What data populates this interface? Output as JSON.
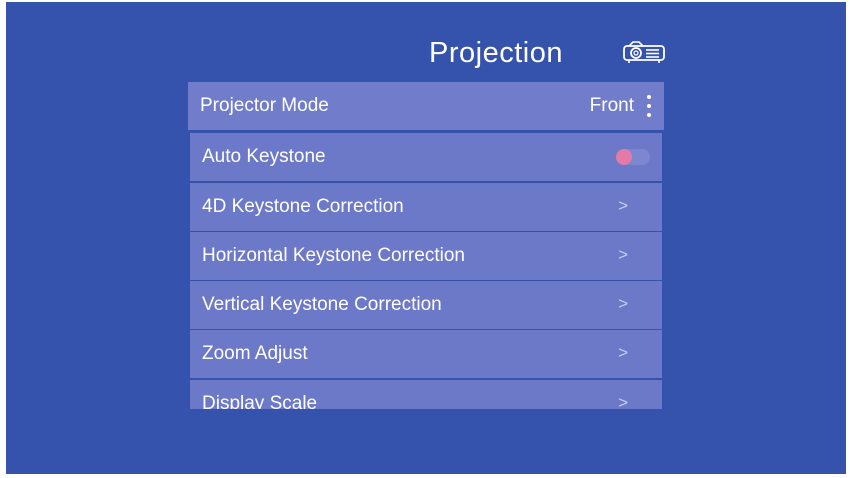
{
  "header": {
    "title": "Projection",
    "icon": "projector-icon"
  },
  "menu": {
    "items": [
      {
        "label": "Projector Mode",
        "value": "Front",
        "control": "more-options-icon",
        "selected": true
      },
      {
        "label": "Auto Keystone",
        "control": "toggle",
        "toggle_on": false,
        "toggle_color": "#e47aa6"
      },
      {
        "label": "4D Keystone Correction",
        "control": "chevron-right-icon",
        "chevron": ">"
      },
      {
        "label": "Horizontal Keystone Correction",
        "control": "chevron-right-icon",
        "chevron": ">"
      },
      {
        "label": "Vertical Keystone Correction",
        "control": "chevron-right-icon",
        "chevron": ">"
      },
      {
        "label": "Zoom Adjust",
        "control": "chevron-right-icon",
        "chevron": ">"
      },
      {
        "label": "Display Scale",
        "control": "chevron-right-icon",
        "chevron": ">"
      }
    ]
  },
  "colors": {
    "background": "#3553ad",
    "row": "#6c78c8",
    "row_selected": "#717dcb",
    "text": "#ffffff"
  }
}
